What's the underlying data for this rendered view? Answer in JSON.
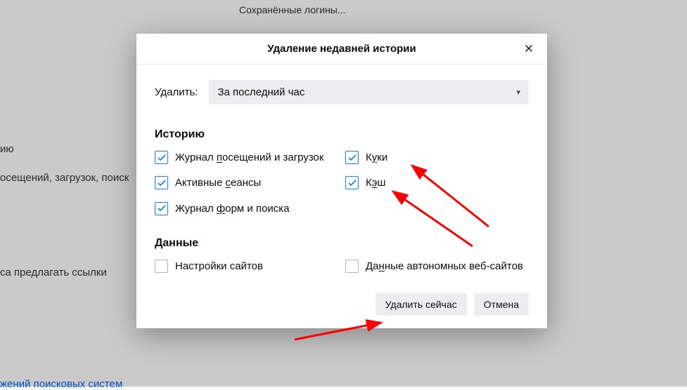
{
  "background": {
    "saved_logins_btn": "Сохранённые логины...",
    "text1": "ию",
    "text2": "осещений, загрузок, поиск",
    "text3": "са предлагать ссылки",
    "link1": "жений поисковых систем"
  },
  "dialog": {
    "title": "Удаление недавней истории",
    "close_aria": "Закрыть",
    "delete_label": "Удалить:",
    "delete_select_value": "За последний час",
    "history_section": "Историю",
    "history_items": [
      {
        "label_pre": "Журнал ",
        "accel": "п",
        "label_post": "осещений и загрузок",
        "checked": true
      },
      {
        "label_pre": "К",
        "accel": "у",
        "label_post": "ки",
        "checked": true
      },
      {
        "label_pre": "Активные ",
        "accel": "с",
        "label_post": "еансы",
        "checked": true
      },
      {
        "label_pre": "К",
        "accel": "э",
        "label_post": "ш",
        "checked": true
      },
      {
        "label_pre": "Журнал ",
        "accel": "ф",
        "label_post": "орм и поиска",
        "checked": true
      }
    ],
    "data_section": "Данные",
    "data_items": [
      {
        "label_pre": "Настройки сайтов",
        "accel": "",
        "label_post": "",
        "checked": false
      },
      {
        "label_pre": "Да",
        "accel": "н",
        "label_post": "ные автономных веб-сайтов",
        "checked": false
      }
    ],
    "delete_now_btn": "Удалить сейчас",
    "cancel_btn": "Отмена"
  }
}
